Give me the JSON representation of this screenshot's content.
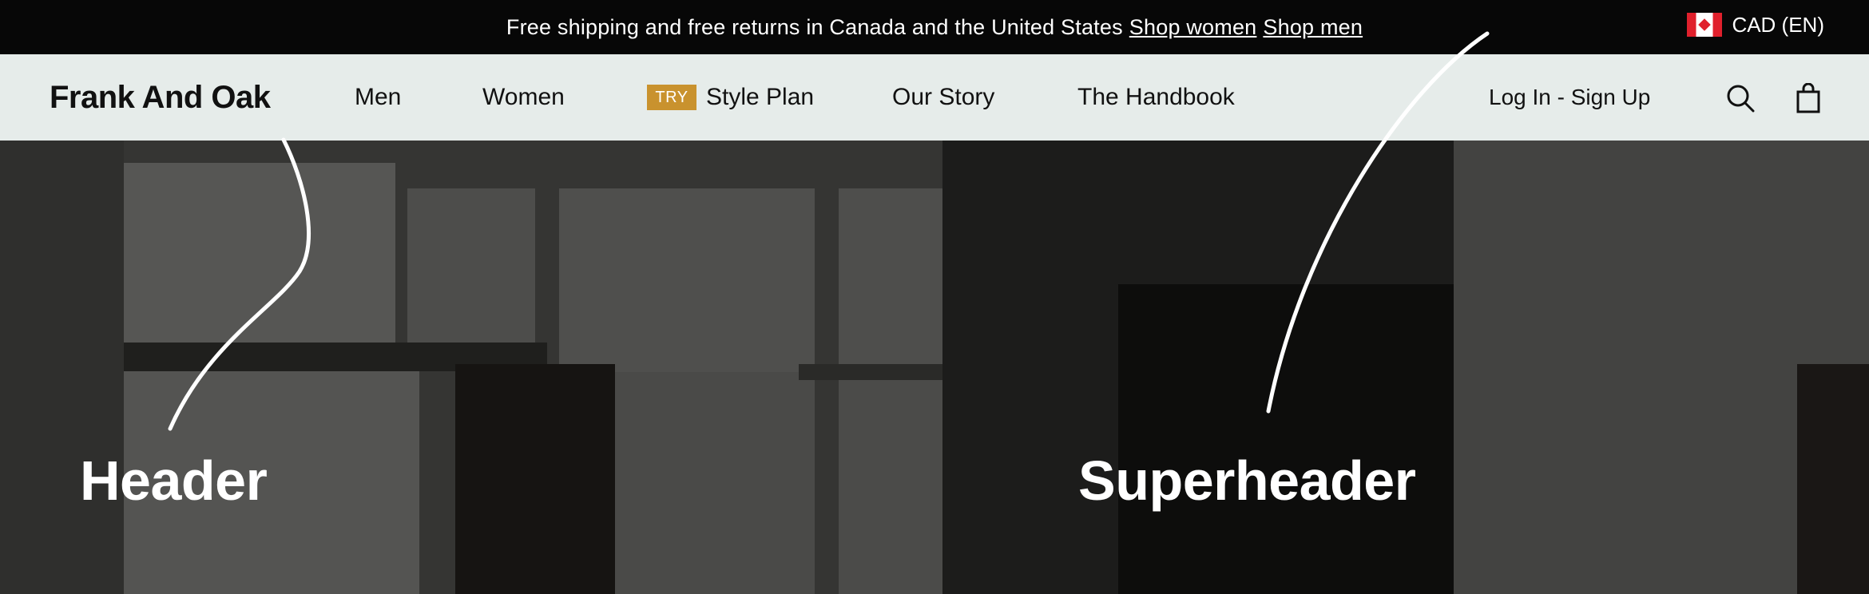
{
  "superheader": {
    "promo_text": "Free shipping and free returns in Canada and the United States",
    "shop_women": "Shop women",
    "shop_men": "Shop men",
    "currency": "CAD (EN)",
    "flag_icon": "canada-flag-icon"
  },
  "header": {
    "logo": "Frank And Oak",
    "nav": {
      "men": "Men",
      "women": "Women",
      "try_badge": "TRY",
      "style_plan": "Style Plan",
      "our_story": "Our Story",
      "handbook": "The Handbook"
    },
    "login": "Log In - Sign Up",
    "search_icon": "search-icon",
    "cart_icon": "shopping-bag-icon"
  },
  "annotations": {
    "header_label": "Header",
    "superheader_label": "Superheader"
  },
  "colors": {
    "superheader_bg": "#070707",
    "header_bg": "#e6ecea",
    "try_badge": "#c9922e",
    "hero_bg": "#353533"
  }
}
